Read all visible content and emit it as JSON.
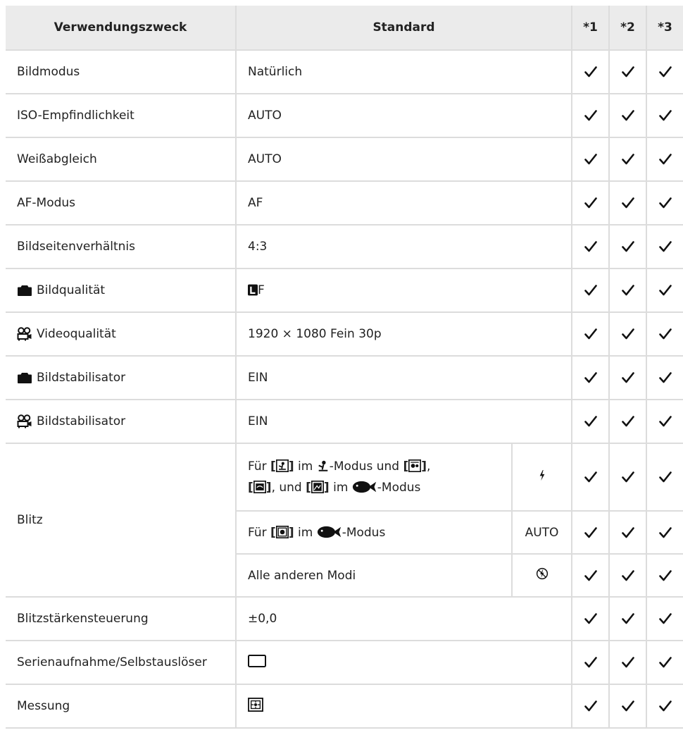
{
  "header": {
    "purpose": "Verwendungszweck",
    "standard": "Standard",
    "col1": "*1",
    "col2": "*2",
    "col3": "*3"
  },
  "rows": [
    {
      "label": "Bildmodus",
      "value": "Natürlich"
    },
    {
      "label": "ISO-Empfindlichkeit",
      "value": "AUTO"
    },
    {
      "label": "Weißabgleich",
      "value": "AUTO"
    },
    {
      "label": "AF-Modus",
      "value": "AF"
    },
    {
      "label": "Bildseitenverhältnis",
      "value": "4:3"
    },
    {
      "label": "Bildqualität",
      "icon": "camera-icon",
      "value_suffix": "F",
      "value_icon": "large-size-icon"
    },
    {
      "label": "Videoqualität",
      "icon": "movie-camera-icon",
      "value": "1920 × 1080 Fein 30p"
    },
    {
      "label": "Bildstabilisator",
      "icon": "camera-icon",
      "value": "EIN"
    },
    {
      "label": "Bildstabilisator",
      "icon": "movie-camera-icon",
      "value": "EIN"
    },
    {
      "label": "Blitzstärkensteuerung",
      "value": "±0,0"
    },
    {
      "label": "Serienaufnahme/Selbstauslöser",
      "value_icon": "single-frame-icon"
    },
    {
      "label": "Messung",
      "value_icon": "metering-icon"
    }
  ],
  "blitz": {
    "label": "Blitz",
    "sub1": {
      "line1_pre": "Für ",
      "line1_mid": " im ",
      "line1_post": "-Modus und ",
      "line2_sep1": ", ",
      "line2_sep2": ", und ",
      "line2_mid": " im ",
      "line2_post": "-Modus",
      "setting_icon": "flash-on-icon"
    },
    "sub2": {
      "pre": "Für ",
      "mid": " im ",
      "post": "-Modus",
      "setting": "AUTO"
    },
    "sub3": {
      "text": "Alle anderen Modi",
      "setting_icon": "flash-off-icon"
    }
  },
  "checkmark": "✓"
}
